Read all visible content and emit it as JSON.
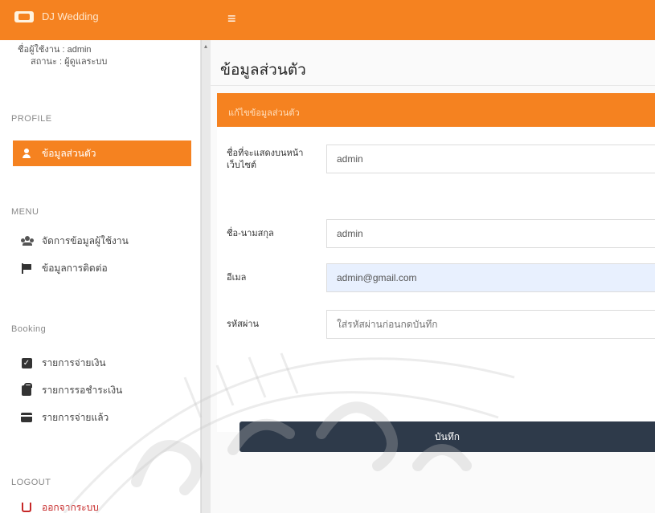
{
  "header": {
    "brand_text": "DJ Wedding",
    "menu_icon": "hamburger-icon"
  },
  "sidebar": {
    "user_line": "ชื่อผู้ใช้งาน : admin",
    "role_line": "สถานะ : ผู้ดูแลระบบ",
    "profile_section": "PROFILE",
    "profile_item": "ข้อมูลส่วนตัว",
    "menu_section": "MENU",
    "menu_items": [
      {
        "label": "จัดการข้อมูลผู้ใช้งาน",
        "icon": "users-icon"
      },
      {
        "label": "ข้อมูลการติดต่อ",
        "icon": "flag-icon"
      }
    ],
    "booking_section": "Booking",
    "booking_items": [
      {
        "label": "รายการจ่ายเงิน",
        "icon": "check-square-icon"
      },
      {
        "label": "รายการรอชำระเงิน",
        "icon": "briefcase-icon"
      },
      {
        "label": "รายการจ่ายแล้ว",
        "icon": "credit-card-icon"
      }
    ],
    "logout_section": "LOGOUT",
    "logout_item": "ออกจากระบบ"
  },
  "main": {
    "page_title": "ข้อมูลส่วนตัว",
    "card_header": "แก้ไขข้อมูลส่วนตัว",
    "fields": [
      {
        "label": "ชื่อที่จะแสดงบนหน้าเว็บไซต์",
        "value": "admin"
      },
      {
        "label": "ชื่อ-นามสกุล",
        "value": "admin"
      },
      {
        "label": "อีเมล",
        "value": "admin@gmail.com"
      },
      {
        "label": "รหัสผ่าน",
        "placeholder": "ใส่รหัสผ่านก่อนกดบันทึก"
      }
    ],
    "save_label": "บันทึก"
  },
  "colors": {
    "accent": "#f58220",
    "save_button": "#2e3a4a",
    "autofill": "#e8f0fe"
  }
}
